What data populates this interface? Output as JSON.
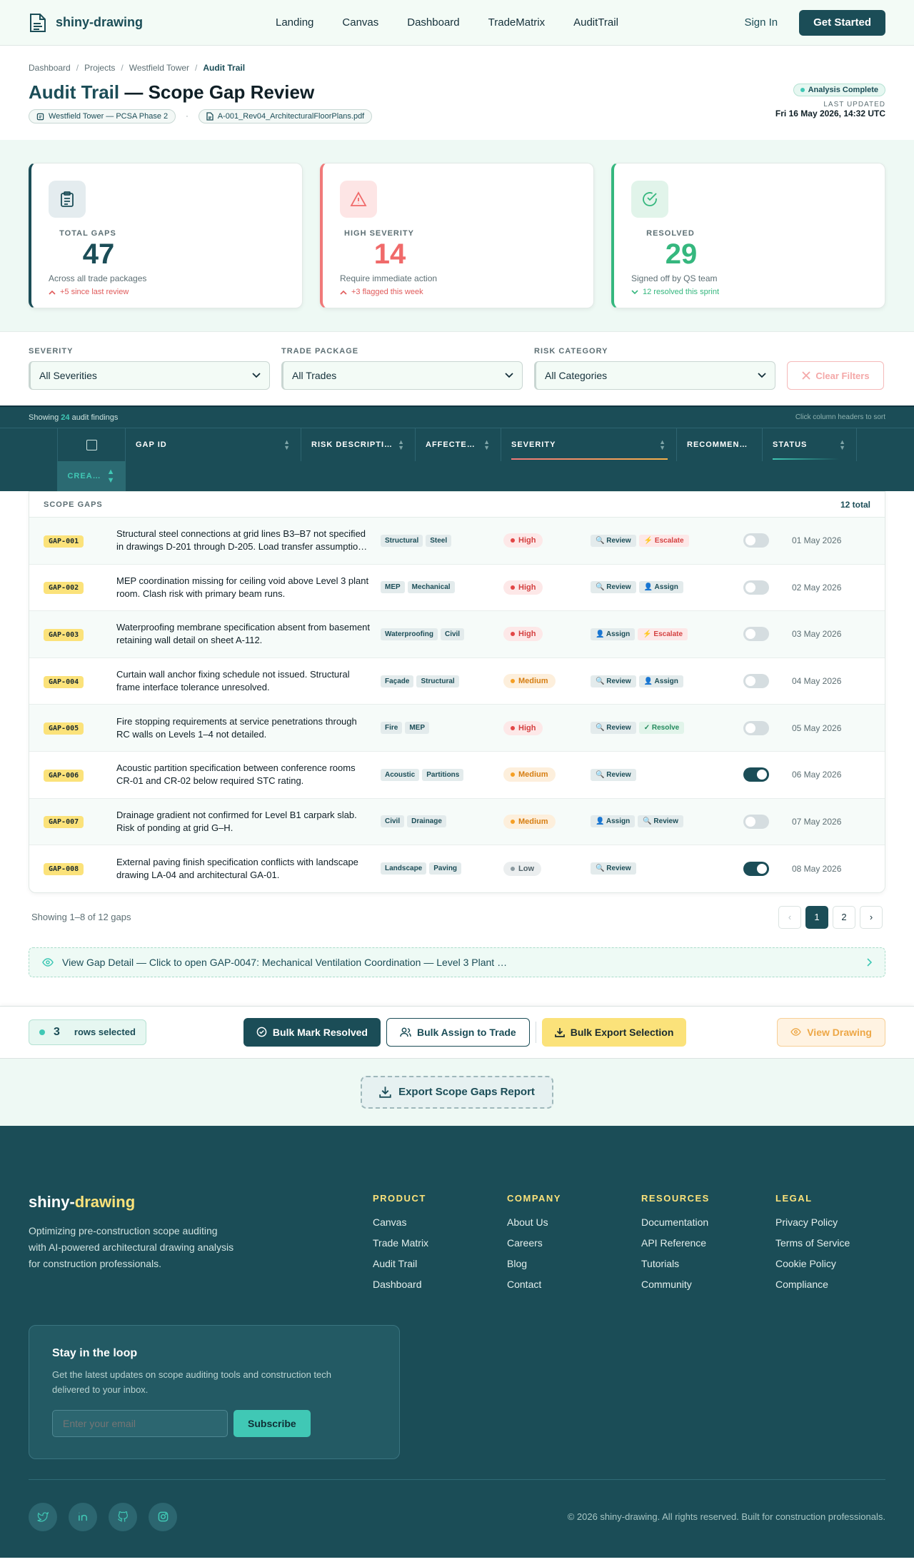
{
  "nav": {
    "brand": "shiny-drawing",
    "links": [
      "Landing",
      "Canvas",
      "Dashboard",
      "TradeMatrix",
      "AuditTrail"
    ],
    "sign_in": "Sign In",
    "cta": "Get Started"
  },
  "header": {
    "breadcrumb": [
      "Dashboard",
      "Projects",
      "Westfield Tower",
      "Audit Trail"
    ],
    "title_accent": "Audit Trail",
    "title_rest": " — Scope Gap Review",
    "project_chip": "Westfield Tower — PCSA Phase 2",
    "chip_separator": "·",
    "file_chip": "A-001_Rev04_ArchitecturalFloorPlans.pdf",
    "status_badge": "Analysis Complete",
    "last_updated_label": "LAST UPDATED",
    "last_updated_value": "Fri 16 May 2026, 14:32 UTC"
  },
  "stats": [
    {
      "label": "TOTAL GAPS",
      "value": "47",
      "desc": "Across all trade packages",
      "trend": "+5 since last review"
    },
    {
      "label": "HIGH SEVERITY",
      "value": "14",
      "desc": "Require immediate action",
      "trend": "+3 flagged this week"
    },
    {
      "label": "RESOLVED",
      "value": "29",
      "desc": "Signed off by QS team",
      "trend": "12 resolved this sprint"
    }
  ],
  "filters": {
    "severity_label": "SEVERITY",
    "severity_value": "All Severities",
    "trade_label": "TRADE PACKAGE",
    "trade_value": "All Trades",
    "risk_label": "RISK CATEGORY",
    "risk_value": "All Categories",
    "clear": "Clear Filters"
  },
  "table_header": {
    "showing_prefix": "Showing ",
    "showing_count": "24",
    "showing_suffix": " audit findings",
    "hint": "Click column headers to sort",
    "columns": [
      "GAP ID",
      "RISK DESCRIPTI…",
      "AFFECTE…",
      "SEVERITY",
      "RECOMMEN…",
      "STATUS",
      "CREA…"
    ]
  },
  "table": {
    "caption": "SCOPE GAPS",
    "total": "12 total",
    "rows": [
      {
        "id": "GAP-001",
        "desc": "Structural steel connections at grid lines B3–B7 not specified in drawings D-201 through D-205. Load transfer assumptio…",
        "tags": [
          "Structural",
          "Steel"
        ],
        "severity": "High",
        "recs": [
          "🔍 Review",
          "⚡ Escalate"
        ],
        "date": "01 May 2026"
      },
      {
        "id": "GAP-002",
        "desc": "MEP coordination missing for ceiling void above Level 3 plant room. Clash risk with primary beam runs.",
        "tags": [
          "MEP",
          "Mechanical"
        ],
        "severity": "High",
        "recs": [
          "🔍 Review",
          "👤 Assign"
        ],
        "date": "02 May 2026"
      },
      {
        "id": "GAP-003",
        "desc": "Waterproofing membrane specification absent from basement retaining wall detail on sheet A-112.",
        "tags": [
          "Waterproofing",
          "Civil"
        ],
        "severity": "High",
        "recs": [
          "👤 Assign",
          "⚡ Escalate"
        ],
        "date": "03 May 2026"
      },
      {
        "id": "GAP-004",
        "desc": "Curtain wall anchor fixing schedule not issued. Structural frame interface tolerance unresolved.",
        "tags": [
          "Façade",
          "Structural"
        ],
        "severity": "Medium",
        "recs": [
          "🔍 Review",
          "👤 Assign"
        ],
        "date": "04 May 2026"
      },
      {
        "id": "GAP-005",
        "desc": "Fire stopping requirements at service penetrations through RC walls on Levels 1–4 not detailed.",
        "tags": [
          "Fire",
          "MEP"
        ],
        "severity": "High",
        "recs": [
          "🔍 Review",
          "✓ Resolve"
        ],
        "date": "05 May 2026"
      },
      {
        "id": "GAP-006",
        "desc": "Acoustic partition specification between conference rooms CR-01 and CR-02 below required STC rating.",
        "tags": [
          "Acoustic",
          "Partitions"
        ],
        "severity": "Medium",
        "recs": [
          "🔍 Review"
        ],
        "date": "06 May 2026"
      },
      {
        "id": "GAP-007",
        "desc": "Drainage gradient not confirmed for Level B1 carpark slab. Risk of ponding at grid G–H.",
        "tags": [
          "Civil",
          "Drainage"
        ],
        "severity": "Medium",
        "recs": [
          "👤 Assign",
          "🔍 Review"
        ],
        "date": "07 May 2026"
      },
      {
        "id": "GAP-008",
        "desc": "External paving finish specification conflicts with landscape drawing LA-04 and architectural GA-01.",
        "tags": [
          "Landscape",
          "Paving"
        ],
        "severity": "Low",
        "recs": [
          "🔍 Review"
        ],
        "date": "08 May 2026"
      }
    ]
  },
  "pager": {
    "summary": "Showing 1–8 of 12 gaps",
    "prev": "‹",
    "pages": [
      "1",
      "2"
    ],
    "next": "›"
  },
  "detail_bar": "View Gap Detail — Click to open GAP-0047: Mechanical Ventilation Coordination — Level 3 Plant …",
  "bulk": {
    "count": "3",
    "label": "rows selected",
    "resolve": "Bulk Mark Resolved",
    "assign": "Bulk Assign to Trade",
    "export": "Bulk Export Selection",
    "view_drawing": "View Drawing"
  },
  "export_report": "Export Scope Gaps Report",
  "footer": {
    "brand_a": "shiny-",
    "brand_b": "drawing",
    "tagline": "Optimizing pre-construction scope auditing with AI-powered architectural drawing analysis for construction professionals.",
    "columns": [
      {
        "head": "PRODUCT",
        "links": [
          "Canvas",
          "Trade Matrix",
          "Audit Trail",
          "Dashboard"
        ]
      },
      {
        "head": "COMPANY",
        "links": [
          "About Us",
          "Careers",
          "Blog",
          "Contact"
        ]
      },
      {
        "head": "RESOURCES",
        "links": [
          "Documentation",
          "API Reference",
          "Tutorials",
          "Community"
        ]
      },
      {
        "head": "LEGAL",
        "links": [
          "Privacy Policy",
          "Terms of Service",
          "Cookie Policy",
          "Compliance"
        ]
      }
    ],
    "newsletter_title": "Stay in the loop",
    "newsletter_text": "Get the latest updates on scope auditing tools and construction tech delivered to your inbox.",
    "email_placeholder": "Enter your email",
    "subscribe": "Subscribe",
    "copyright": "© 2026 shiny-drawing. All rights reserved. Built for construction professionals."
  },
  "colors": {
    "primary": "#1b4d57",
    "accent": "#40c8b5",
    "yellow": "#fbe27a",
    "danger": "#f07979",
    "success": "#35b77e"
  }
}
